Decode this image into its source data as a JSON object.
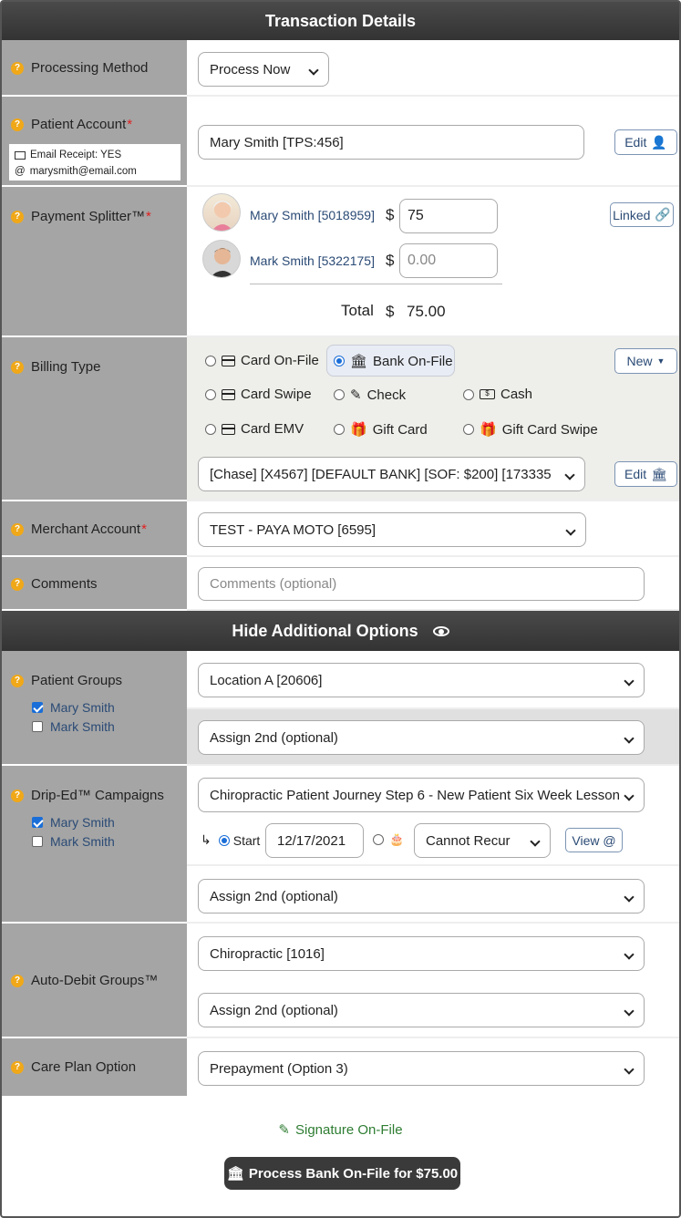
{
  "header": {
    "title": "Transaction Details"
  },
  "processing_method": {
    "label": "Processing Method",
    "value": "Process Now"
  },
  "patient_account": {
    "label": "Patient Account",
    "value": "Mary Smith [TPS:456]",
    "email_receipt": "Email Receipt: YES",
    "email": "marysmith@email.com",
    "edit_label": "Edit"
  },
  "payment_splitter": {
    "label": "Payment Splitter™",
    "linked_label": "Linked",
    "currency": "$",
    "patients": [
      {
        "name": "Mary Smith [5018959]",
        "amount": "75",
        "placeholder": ""
      },
      {
        "name": "Mark Smith [5322175]",
        "amount": "",
        "placeholder": "0.00"
      }
    ],
    "total_label": "Total",
    "total_value": "75.00"
  },
  "billing_type": {
    "label": "Billing Type",
    "new_label": "New",
    "options": {
      "card_on_file": "Card On-File",
      "bank_on_file": "Bank On-File",
      "card_swipe": "Card Swipe",
      "check": "Check",
      "cash": "Cash",
      "card_emv": "Card EMV",
      "gift_card": "Gift Card",
      "gift_card_swipe": "Gift Card Swipe"
    },
    "selected": "bank_on_file",
    "account_value": "[Chase] [X4567] [DEFAULT BANK] [SOF: $200] [173335",
    "edit_label": "Edit"
  },
  "merchant_account": {
    "label": "Merchant Account",
    "value": "TEST - PAYA MOTO [6595]"
  },
  "comments": {
    "label": "Comments",
    "placeholder": "Comments (optional)"
  },
  "additional_header": {
    "title": "Hide Additional Options"
  },
  "patient_groups": {
    "label": "Patient Groups",
    "value": "Location A [20606]",
    "second": "Assign 2nd (optional)",
    "patients": [
      {
        "name": "Mary Smith",
        "checked": true
      },
      {
        "name": "Mark Smith",
        "checked": false
      }
    ]
  },
  "drip_campaigns": {
    "label": "Drip-Ed™ Campaigns",
    "value": "Chiropractic Patient Journey Step 6 - New Patient Six Week Lesson",
    "start_label": "Start",
    "start_date": "12/17/2021",
    "recur_value": "Cannot Recur",
    "view_label": "View @",
    "second": "Assign 2nd (optional)",
    "patients": [
      {
        "name": "Mary Smith",
        "checked": true
      },
      {
        "name": "Mark Smith",
        "checked": false
      }
    ]
  },
  "auto_debit": {
    "label": "Auto-Debit Groups™",
    "value": "Chiropractic [1016]",
    "second": "Assign 2nd (optional)"
  },
  "care_plan": {
    "label": "Care Plan Option",
    "value": "Prepayment (Option 3)"
  },
  "signature": {
    "label": "Signature On-File"
  },
  "submit": {
    "label": "Process Bank On-File for $75.00"
  }
}
